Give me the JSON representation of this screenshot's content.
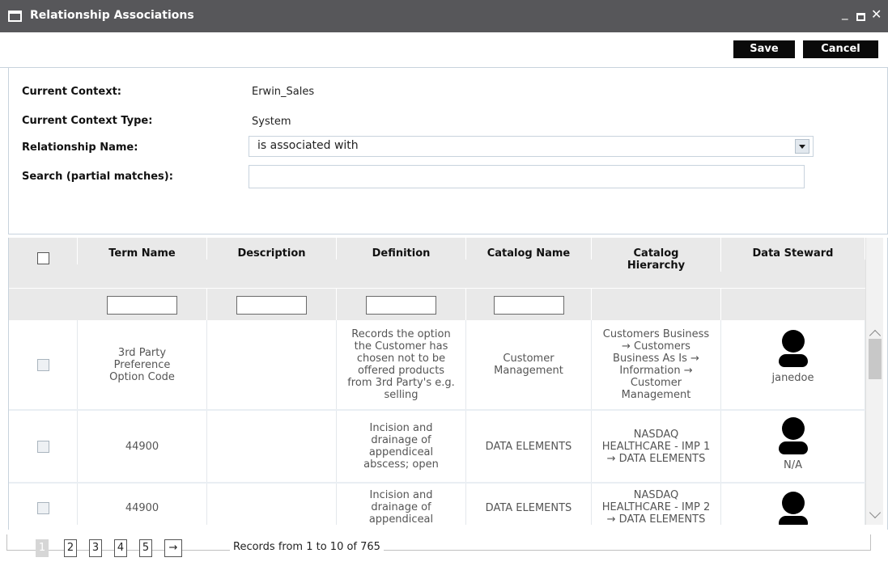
{
  "window": {
    "title": "Relationship Associations",
    "min": "_",
    "close": "✕"
  },
  "toolbar": {
    "save_label": "Save",
    "cancel_label": "Cancel"
  },
  "form": {
    "context_label": "Current Context:",
    "context_value": "Erwin_Sales",
    "context_type_label": "Current Context Type:",
    "context_type_value": "System",
    "relationship_label": "Relationship Name:",
    "relationship_value": "is associated with",
    "search_label": "Search (partial matches):",
    "search_value": ""
  },
  "grid": {
    "columns": [
      "Term Name",
      "Description",
      "Definition",
      "Catalog Name",
      "Catalog Hierarchy",
      "Data Steward"
    ],
    "rows": [
      {
        "term": "3rd Party Preference Option Code",
        "description": "",
        "definition": "Records the option the Customer has chosen not to be offered products from 3rd Party's e.g. selling",
        "catalog": "Customer Management",
        "hierarchy": "Customers Business → Customers Business As Is → Information → Customer Management",
        "steward": "janedoe"
      },
      {
        "term": "44900",
        "description": "",
        "definition": "Incision and drainage of appendiceal abscess; open",
        "catalog": "DATA ELEMENTS",
        "hierarchy": "NASDAQ HEALTHCARE - IMP 1 → DATA ELEMENTS",
        "steward": "N/A"
      },
      {
        "term": "44900",
        "description": "",
        "definition": "Incision and drainage of appendiceal abscess; open",
        "catalog": "DATA ELEMENTS",
        "hierarchy": "NASDAQ HEALTHCARE - IMP 2 → DATA ELEMENTS",
        "steward": ""
      }
    ]
  },
  "pager": {
    "pages": [
      "1",
      "2",
      "3",
      "4",
      "5"
    ],
    "next": "→",
    "records_text": "Records from 1 to 10 of 765"
  }
}
